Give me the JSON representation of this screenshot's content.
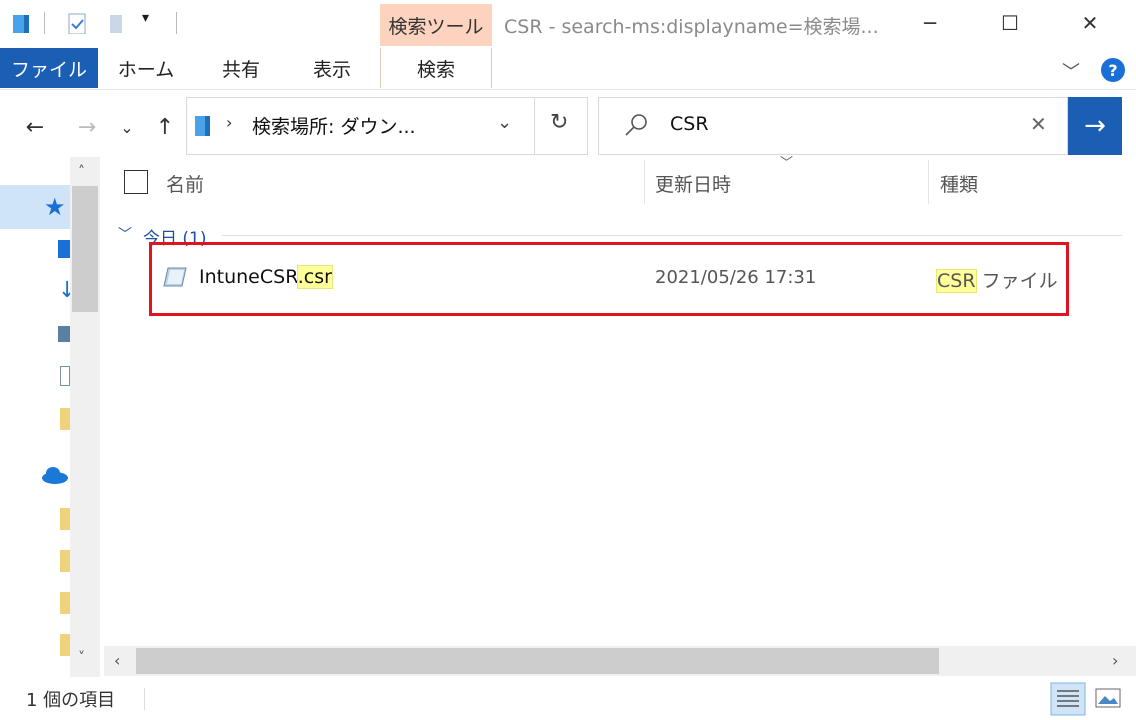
{
  "titlebar": {
    "title": "CSR - search-ms:displayname=検索場...",
    "minimize": "─",
    "maximize": "☐",
    "close": "✕"
  },
  "ribbon": {
    "file_tab": "ファイル",
    "home_tab": "ホーム",
    "share_tab": "共有",
    "view_tab": "表示",
    "context_group": "検索ツール",
    "search_tab": "検索",
    "help": "?"
  },
  "address": {
    "path": "検索場所: ダウン..."
  },
  "search": {
    "query": "CSR"
  },
  "columns": {
    "name": "名前",
    "date": "更新日時",
    "type": "種類"
  },
  "group": {
    "label": "今日 (1)"
  },
  "files": [
    {
      "name_base": "IntuneCSR",
      "name_ext": ".csr",
      "modified": "2021/05/26 17:31",
      "type_highlight": "CSR",
      "type_rest": " ファイル"
    }
  ],
  "status": {
    "item_count": "1 個の項目"
  },
  "colors": {
    "accent": "#1a5fb4",
    "context_tab": "#fbd3bf",
    "highlight": "#ffff99",
    "annotation": "#e0141e"
  }
}
